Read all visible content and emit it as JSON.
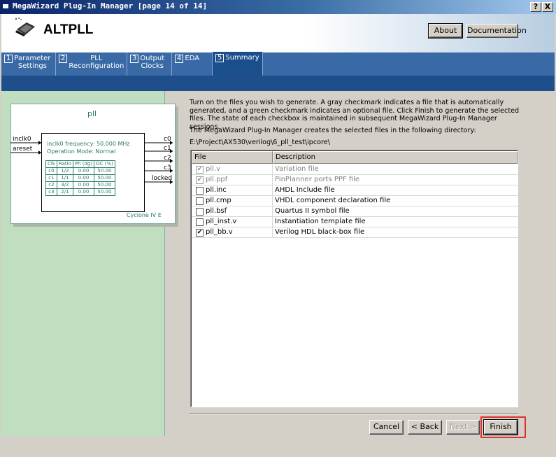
{
  "window": {
    "title": "MegaWizard Plug-In Manager [page 14 of 14]",
    "help_btn": "?",
    "close_btn": "X"
  },
  "header": {
    "app_title": "ALTPLL",
    "about_label": "About",
    "documentation_label": "Documentation"
  },
  "tabs": [
    {
      "num": "1",
      "label": "Parameter\nSettings"
    },
    {
      "num": "2",
      "label": "PLL\nReconfiguration"
    },
    {
      "num": "3",
      "label": "Output\nClocks"
    },
    {
      "num": "4",
      "label": "EDA"
    },
    {
      "num": "5",
      "label": "Summary",
      "active": true
    }
  ],
  "diagram": {
    "name": "pll",
    "inputs": [
      "inclk0",
      "areset"
    ],
    "outputs": [
      "c0",
      "c1",
      "c2",
      "c3",
      "locked"
    ],
    "info_line1": "inclk0 frequency: 50.000 MHz",
    "info_line2": "Operation Mode: Normal",
    "table_header": [
      "Clk",
      "Ratio",
      "Ph (dg)",
      "DC (%)"
    ],
    "table_rows": [
      [
        "c0",
        "1/2",
        "0.00",
        "50.00"
      ],
      [
        "c1",
        "1/1",
        "0.00",
        "50.00"
      ],
      [
        "c2",
        "3/2",
        "0.00",
        "50.00"
      ],
      [
        "c3",
        "2/1",
        "0.00",
        "50.00"
      ]
    ],
    "device": "Cyclone IV E"
  },
  "content": {
    "description": "Turn on the files you wish to generate. A gray checkmark indicates a file that is automatically generated, and a green checkmark indicates an optional file. Click Finish to generate the selected files. The state of each checkbox is maintained in subsequent MegaWizard Plug-In Manager sessions.",
    "dir_label": "The MegaWizard Plug-In Manager creates the selected files in the following directory:",
    "dir_path": "E:\\Project\\AX530\\verilog\\6_pll_test\\ipcore\\"
  },
  "files": {
    "col_file": "File",
    "col_desc": "Description",
    "rows": [
      {
        "name": "pll.v",
        "desc": "Variation file",
        "checked": true,
        "auto": true
      },
      {
        "name": "pll.ppf",
        "desc": "PinPlanner ports PPF file",
        "checked": true,
        "auto": true
      },
      {
        "name": "pll.inc",
        "desc": "AHDL Include file",
        "checked": false,
        "auto": false
      },
      {
        "name": "pll.cmp",
        "desc": "VHDL component declaration file",
        "checked": false,
        "auto": false
      },
      {
        "name": "pll.bsf",
        "desc": "Quartus II symbol file",
        "checked": false,
        "auto": false
      },
      {
        "name": "pll_inst.v",
        "desc": "Instantiation template file",
        "checked": false,
        "auto": false
      },
      {
        "name": "pll_bb.v",
        "desc": "Verilog HDL black-box file",
        "checked": true,
        "auto": false
      }
    ]
  },
  "footer": {
    "cancel_label": "Cancel",
    "back_label": "< Back",
    "next_label": "Next >",
    "finish_label": "Finish"
  }
}
